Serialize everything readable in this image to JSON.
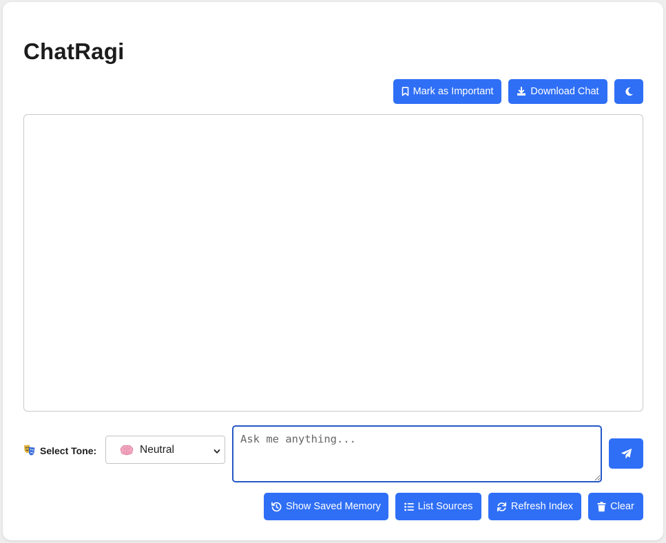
{
  "app": {
    "title": "ChatRagi"
  },
  "toolbar": {
    "mark_important_label": "Mark as Important",
    "download_chat_label": "Download Chat",
    "theme_toggle_icon": "moon-icon"
  },
  "tone": {
    "label": "Select Tone:",
    "label_icon": "theater-masks-icon",
    "selected": "Neutral",
    "selected_icon": "brain-icon"
  },
  "input": {
    "placeholder": "Ask me anything...",
    "value": ""
  },
  "send": {
    "icon": "paper-plane-icon"
  },
  "actions": {
    "show_memory_label": "Show Saved Memory",
    "list_sources_label": "List Sources",
    "refresh_index_label": "Refresh Index",
    "clear_label": "Clear"
  },
  "colors": {
    "accent": "#2f6ff6",
    "input_focus_border": "#2457c5",
    "card_background": "#ffffff",
    "page_background": "#eeeeee"
  }
}
